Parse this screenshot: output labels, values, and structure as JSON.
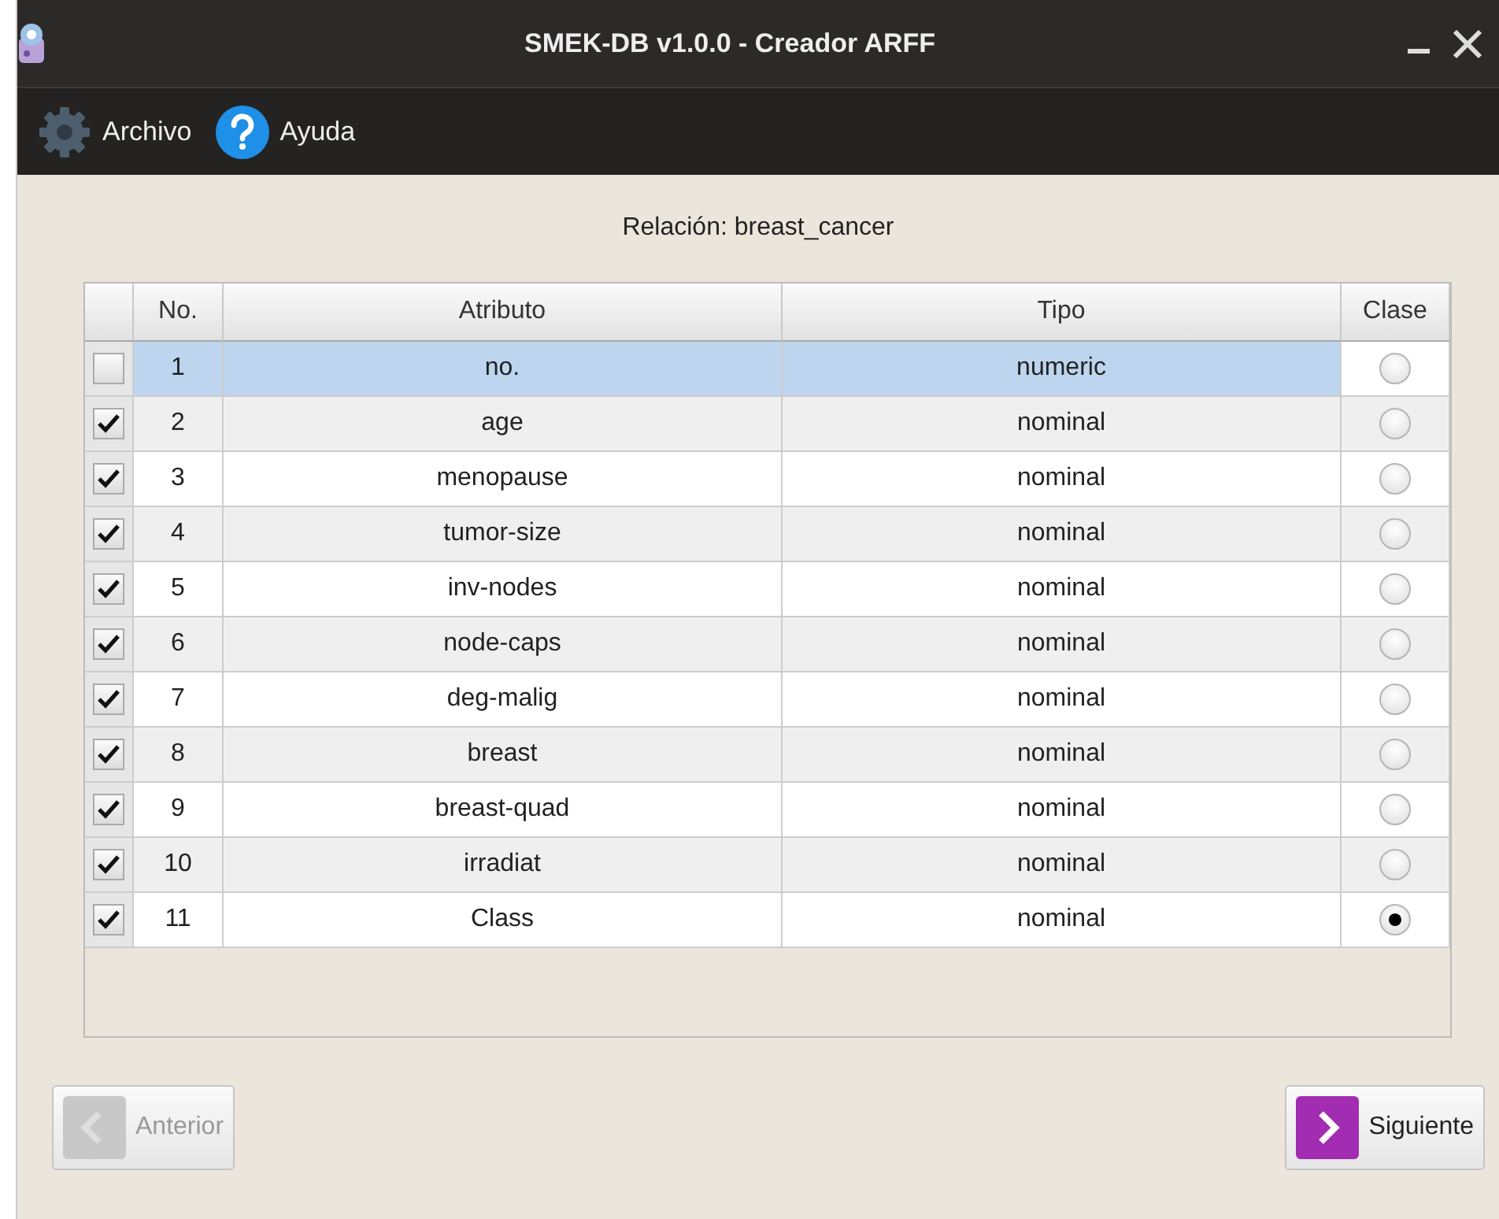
{
  "window": {
    "title": "SMEK-DB v1.0.0 - Creador ARFF"
  },
  "menu": [
    {
      "label": "Archivo",
      "kind": "gear"
    },
    {
      "label": "Ayuda",
      "kind": "help"
    }
  ],
  "relation": "Relación: breast_cancer",
  "table": {
    "columns": [
      "No.",
      "Atributo",
      "Tipo",
      "Clase"
    ],
    "rows": [
      {
        "no": "1",
        "attribute": "no.",
        "type": "numeric",
        "checked": false,
        "selected": true,
        "is_class": false
      },
      {
        "no": "2",
        "attribute": "age",
        "type": "nominal",
        "checked": true,
        "selected": false,
        "is_class": false
      },
      {
        "no": "3",
        "attribute": "menopause",
        "type": "nominal",
        "checked": true,
        "selected": false,
        "is_class": false
      },
      {
        "no": "4",
        "attribute": "tumor-size",
        "type": "nominal",
        "checked": true,
        "selected": false,
        "is_class": false
      },
      {
        "no": "5",
        "attribute": "inv-nodes",
        "type": "nominal",
        "checked": true,
        "selected": false,
        "is_class": false
      },
      {
        "no": "6",
        "attribute": "node-caps",
        "type": "nominal",
        "checked": true,
        "selected": false,
        "is_class": false
      },
      {
        "no": "7",
        "attribute": "deg-malig",
        "type": "nominal",
        "checked": true,
        "selected": false,
        "is_class": false
      },
      {
        "no": "8",
        "attribute": "breast",
        "type": "nominal",
        "checked": true,
        "selected": false,
        "is_class": false
      },
      {
        "no": "9",
        "attribute": "breast-quad",
        "type": "nominal",
        "checked": true,
        "selected": false,
        "is_class": false
      },
      {
        "no": "10",
        "attribute": "irradiat",
        "type": "nominal",
        "checked": true,
        "selected": false,
        "is_class": false
      },
      {
        "no": "11",
        "attribute": "Class",
        "type": "nominal",
        "checked": true,
        "selected": false,
        "is_class": true
      }
    ]
  },
  "buttons": [
    {
      "label": "Anterior",
      "kind": "back",
      "disabled": true
    },
    {
      "label": "Siguiente",
      "kind": "next",
      "disabled": false
    }
  ]
}
